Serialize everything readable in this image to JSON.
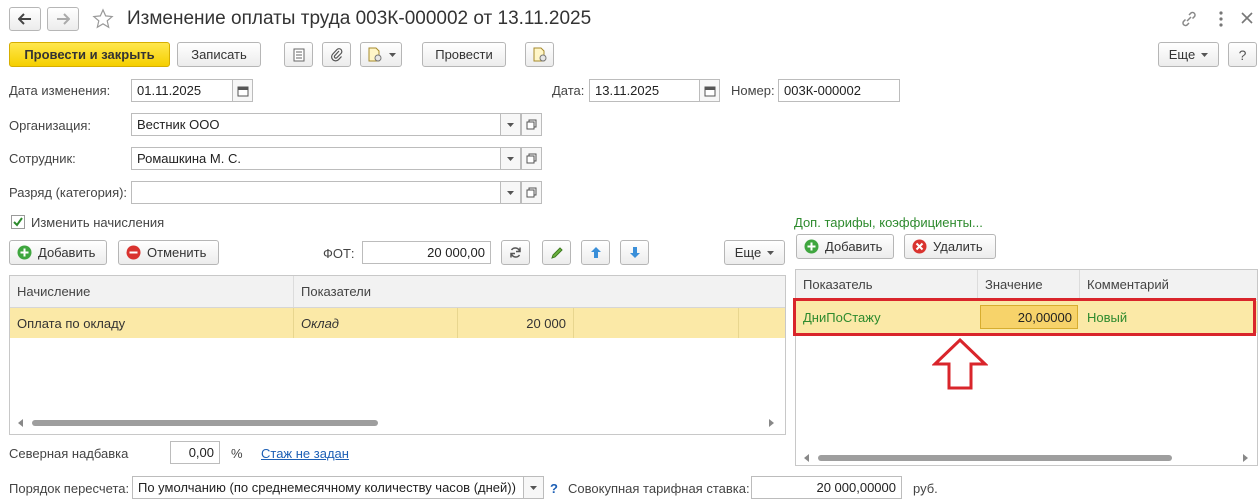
{
  "window": {
    "title": "Изменение оплаты труда 003К-000002 от 13.11.2025"
  },
  "toolbar": {
    "post_close": "Провести и закрыть",
    "save": "Записать",
    "post": "Провести",
    "more": "Еще"
  },
  "header": {
    "change_date_label": "Дата изменения:",
    "change_date": "01.11.2025",
    "date_label": "Дата:",
    "date": "13.11.2025",
    "number_label": "Номер:",
    "number": "003К-000002",
    "org_label": "Организация:",
    "org": "Вестник ООО",
    "employee_label": "Сотрудник:",
    "employee": "Ромашкина М. С.",
    "grade_label": "Разряд (категория):",
    "grade": ""
  },
  "accruals": {
    "checkbox_label": "Изменить начисления",
    "checked": true,
    "add": "Добавить",
    "cancel": "Отменить",
    "fot_label": "ФОТ:",
    "fot": "20 000,00",
    "more": "Еще",
    "columns": [
      "Начисление",
      "Показатели"
    ],
    "rows": [
      {
        "accrual": "Оплата по окладу",
        "indicator": "Оклад",
        "value": "20 000"
      }
    ]
  },
  "tariffs": {
    "title": "Доп. тарифы, коэффициенты...",
    "add": "Добавить",
    "delete": "Удалить",
    "columns": [
      "Показатель",
      "Значение",
      "Комментарий"
    ],
    "rows": [
      {
        "indicator": "ДниПоСтажу",
        "value": "20,00000",
        "comment": "Новый"
      }
    ]
  },
  "footer": {
    "north_label": "Северная надбавка",
    "north_value": "0,00",
    "percent": "%",
    "experience_link": "Стаж не задан",
    "recalc_label": "Порядок пересчета:",
    "recalc_value": "По умолчанию (по среднемесячному количеству часов (дней))",
    "help": "?",
    "total_label": "Совокупная тарифная ставка:",
    "total_value": "20 000,00000",
    "currency": "руб."
  },
  "colors": {
    "primary_button": "#f5cf00",
    "selected_row": "#fbe9a7",
    "highlight_border": "#d9252b",
    "green_text": "#2d8a2d",
    "link": "#1d5fb5"
  }
}
